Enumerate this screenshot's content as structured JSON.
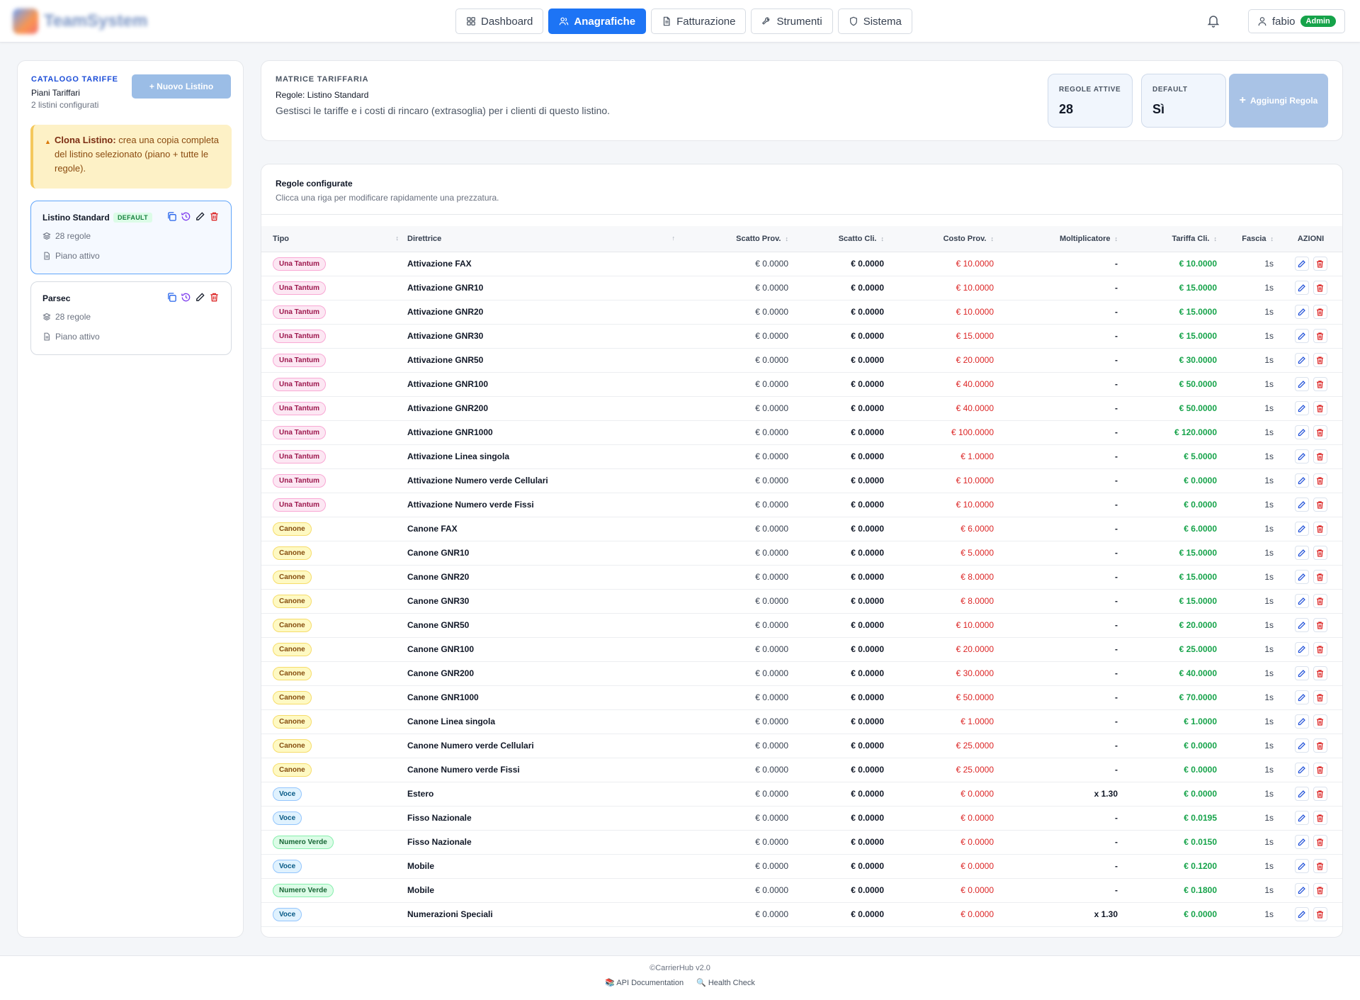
{
  "app": {
    "logo_text": "TeamSystem"
  },
  "nav": {
    "tabs": [
      {
        "label": "Dashboard",
        "icon": "grid-icon",
        "active": false
      },
      {
        "label": "Anagrafiche",
        "icon": "users-icon",
        "active": true
      },
      {
        "label": "Fatturazione",
        "icon": "document-icon",
        "active": false
      },
      {
        "label": "Strumenti",
        "icon": "wrench-icon",
        "active": false
      },
      {
        "label": "Sistema",
        "icon": "shield-icon",
        "active": false
      }
    ],
    "user": {
      "name": "fabio",
      "role": "Admin"
    }
  },
  "sidebar": {
    "title": "CATALOGO TARIFFE",
    "subtitle": "Piani Tariffari",
    "count": "2 listini configurati",
    "new_button": "+ Nuovo Listino",
    "clone_alert": {
      "title": "Clona Listino:",
      "text": "crea una copia completa del listino selezionato (piano + tutte le regole)."
    },
    "listini": [
      {
        "name": "Listino Standard",
        "badge": "DEFAULT",
        "rules": "28 regole",
        "status": "Piano attivo"
      },
      {
        "name": "Parsec",
        "badge": "",
        "rules": "28 regole",
        "status": "Piano attivo"
      }
    ]
  },
  "matrice": {
    "title": "MATRICE TARIFFARIA",
    "subtitle": "Regole: Listino Standard",
    "description": "Gestisci le tariffe e i costi di rincaro (extrasoglia) per i clienti di questo listino.",
    "stats": [
      {
        "label": "REGOLE ATTIVE",
        "value": "28"
      },
      {
        "label": "DEFAULT",
        "value": "Sì"
      }
    ],
    "add_button": "Aggiungi Regola"
  },
  "rules": {
    "title": "Regole configurate",
    "subtitle": "Clicca una riga per modificare rapidamente una prezzatura.",
    "columns": {
      "tipo": "Tipo",
      "direttrice": "Direttrice",
      "scatto_prov": "Scatto Prov.",
      "scatto_cli": "Scatto Cli.",
      "costo_prov": "Costo Prov.",
      "moltiplicatore": "Moltiplicatore",
      "tariffa_cli": "Tariffa Cli.",
      "fascia": "Fascia",
      "azioni": "AZIONI"
    },
    "rows": [
      {
        "tipo": "Una Tantum",
        "kind": "una",
        "dir": "Attivazione FAX",
        "sp": "€ 0.0000",
        "sc": "€ 0.0000",
        "cp": "€ 10.0000",
        "mol": "-",
        "tc": "€ 10.0000",
        "fa": "1s"
      },
      {
        "tipo": "Una Tantum",
        "kind": "una",
        "dir": "Attivazione GNR10",
        "sp": "€ 0.0000",
        "sc": "€ 0.0000",
        "cp": "€ 10.0000",
        "mol": "-",
        "tc": "€ 15.0000",
        "fa": "1s"
      },
      {
        "tipo": "Una Tantum",
        "kind": "una",
        "dir": "Attivazione GNR20",
        "sp": "€ 0.0000",
        "sc": "€ 0.0000",
        "cp": "€ 10.0000",
        "mol": "-",
        "tc": "€ 15.0000",
        "fa": "1s"
      },
      {
        "tipo": "Una Tantum",
        "kind": "una",
        "dir": "Attivazione GNR30",
        "sp": "€ 0.0000",
        "sc": "€ 0.0000",
        "cp": "€ 15.0000",
        "mol": "-",
        "tc": "€ 15.0000",
        "fa": "1s"
      },
      {
        "tipo": "Una Tantum",
        "kind": "una",
        "dir": "Attivazione GNR50",
        "sp": "€ 0.0000",
        "sc": "€ 0.0000",
        "cp": "€ 20.0000",
        "mol": "-",
        "tc": "€ 30.0000",
        "fa": "1s"
      },
      {
        "tipo": "Una Tantum",
        "kind": "una",
        "dir": "Attivazione GNR100",
        "sp": "€ 0.0000",
        "sc": "€ 0.0000",
        "cp": "€ 40.0000",
        "mol": "-",
        "tc": "€ 50.0000",
        "fa": "1s"
      },
      {
        "tipo": "Una Tantum",
        "kind": "una",
        "dir": "Attivazione GNR200",
        "sp": "€ 0.0000",
        "sc": "€ 0.0000",
        "cp": "€ 40.0000",
        "mol": "-",
        "tc": "€ 50.0000",
        "fa": "1s"
      },
      {
        "tipo": "Una Tantum",
        "kind": "una",
        "dir": "Attivazione GNR1000",
        "sp": "€ 0.0000",
        "sc": "€ 0.0000",
        "cp": "€ 100.0000",
        "mol": "-",
        "tc": "€ 120.0000",
        "fa": "1s"
      },
      {
        "tipo": "Una Tantum",
        "kind": "una",
        "dir": "Attivazione Linea singola",
        "sp": "€ 0.0000",
        "sc": "€ 0.0000",
        "cp": "€ 1.0000",
        "mol": "-",
        "tc": "€ 5.0000",
        "fa": "1s"
      },
      {
        "tipo": "Una Tantum",
        "kind": "una",
        "dir": "Attivazione Numero verde Cellulari",
        "sp": "€ 0.0000",
        "sc": "€ 0.0000",
        "cp": "€ 10.0000",
        "mol": "-",
        "tc": "€ 0.0000",
        "fa": "1s"
      },
      {
        "tipo": "Una Tantum",
        "kind": "una",
        "dir": "Attivazione Numero verde Fissi",
        "sp": "€ 0.0000",
        "sc": "€ 0.0000",
        "cp": "€ 10.0000",
        "mol": "-",
        "tc": "€ 0.0000",
        "fa": "1s"
      },
      {
        "tipo": "Canone",
        "kind": "canone",
        "dir": "Canone FAX",
        "sp": "€ 0.0000",
        "sc": "€ 0.0000",
        "cp": "€ 6.0000",
        "mol": "-",
        "tc": "€ 6.0000",
        "fa": "1s"
      },
      {
        "tipo": "Canone",
        "kind": "canone",
        "dir": "Canone GNR10",
        "sp": "€ 0.0000",
        "sc": "€ 0.0000",
        "cp": "€ 5.0000",
        "mol": "-",
        "tc": "€ 15.0000",
        "fa": "1s"
      },
      {
        "tipo": "Canone",
        "kind": "canone",
        "dir": "Canone GNR20",
        "sp": "€ 0.0000",
        "sc": "€ 0.0000",
        "cp": "€ 8.0000",
        "mol": "-",
        "tc": "€ 15.0000",
        "fa": "1s"
      },
      {
        "tipo": "Canone",
        "kind": "canone",
        "dir": "Canone GNR30",
        "sp": "€ 0.0000",
        "sc": "€ 0.0000",
        "cp": "€ 8.0000",
        "mol": "-",
        "tc": "€ 15.0000",
        "fa": "1s"
      },
      {
        "tipo": "Canone",
        "kind": "canone",
        "dir": "Canone GNR50",
        "sp": "€ 0.0000",
        "sc": "€ 0.0000",
        "cp": "€ 10.0000",
        "mol": "-",
        "tc": "€ 20.0000",
        "fa": "1s"
      },
      {
        "tipo": "Canone",
        "kind": "canone",
        "dir": "Canone GNR100",
        "sp": "€ 0.0000",
        "sc": "€ 0.0000",
        "cp": "€ 20.0000",
        "mol": "-",
        "tc": "€ 25.0000",
        "fa": "1s"
      },
      {
        "tipo": "Canone",
        "kind": "canone",
        "dir": "Canone GNR200",
        "sp": "€ 0.0000",
        "sc": "€ 0.0000",
        "cp": "€ 30.0000",
        "mol": "-",
        "tc": "€ 40.0000",
        "fa": "1s"
      },
      {
        "tipo": "Canone",
        "kind": "canone",
        "dir": "Canone GNR1000",
        "sp": "€ 0.0000",
        "sc": "€ 0.0000",
        "cp": "€ 50.0000",
        "mol": "-",
        "tc": "€ 70.0000",
        "fa": "1s"
      },
      {
        "tipo": "Canone",
        "kind": "canone",
        "dir": "Canone Linea singola",
        "sp": "€ 0.0000",
        "sc": "€ 0.0000",
        "cp": "€ 1.0000",
        "mol": "-",
        "tc": "€ 1.0000",
        "fa": "1s"
      },
      {
        "tipo": "Canone",
        "kind": "canone",
        "dir": "Canone Numero verde Cellulari",
        "sp": "€ 0.0000",
        "sc": "€ 0.0000",
        "cp": "€ 25.0000",
        "mol": "-",
        "tc": "€ 0.0000",
        "fa": "1s"
      },
      {
        "tipo": "Canone",
        "kind": "canone",
        "dir": "Canone Numero verde Fissi",
        "sp": "€ 0.0000",
        "sc": "€ 0.0000",
        "cp": "€ 25.0000",
        "mol": "-",
        "tc": "€ 0.0000",
        "fa": "1s"
      },
      {
        "tipo": "Voce",
        "kind": "voce",
        "dir": "Estero",
        "sp": "€ 0.0000",
        "sc": "€ 0.0000",
        "cp": "€ 0.0000",
        "mol": "x 1.30",
        "tc": "€ 0.0000",
        "fa": "1s"
      },
      {
        "tipo": "Voce",
        "kind": "voce",
        "dir": "Fisso Nazionale",
        "sp": "€ 0.0000",
        "sc": "€ 0.0000",
        "cp": "€ 0.0000",
        "mol": "-",
        "tc": "€ 0.0195",
        "fa": "1s"
      },
      {
        "tipo": "Numero Verde",
        "kind": "verde",
        "dir": "Fisso Nazionale",
        "sp": "€ 0.0000",
        "sc": "€ 0.0000",
        "cp": "€ 0.0000",
        "mol": "-",
        "tc": "€ 0.0150",
        "fa": "1s"
      },
      {
        "tipo": "Voce",
        "kind": "voce",
        "dir": "Mobile",
        "sp": "€ 0.0000",
        "sc": "€ 0.0000",
        "cp": "€ 0.0000",
        "mol": "-",
        "tc": "€ 0.1200",
        "fa": "1s"
      },
      {
        "tipo": "Numero Verde",
        "kind": "verde",
        "dir": "Mobile",
        "sp": "€ 0.0000",
        "sc": "€ 0.0000",
        "cp": "€ 0.0000",
        "mol": "-",
        "tc": "€ 0.1800",
        "fa": "1s"
      },
      {
        "tipo": "Voce",
        "kind": "voce",
        "dir": "Numerazioni Speciali",
        "sp": "€ 0.0000",
        "sc": "€ 0.0000",
        "cp": "€ 0.0000",
        "mol": "x 1.30",
        "tc": "€ 0.0000",
        "fa": "1s"
      }
    ]
  },
  "footer": {
    "copyright": "©CarrierHub v2.0",
    "links": [
      {
        "label": "📚 API Documentation"
      },
      {
        "label": "🔍 Health Check"
      }
    ]
  },
  "colors": {
    "primary": "#1d74f5",
    "danger": "#dc2626",
    "success": "#16a34a"
  }
}
